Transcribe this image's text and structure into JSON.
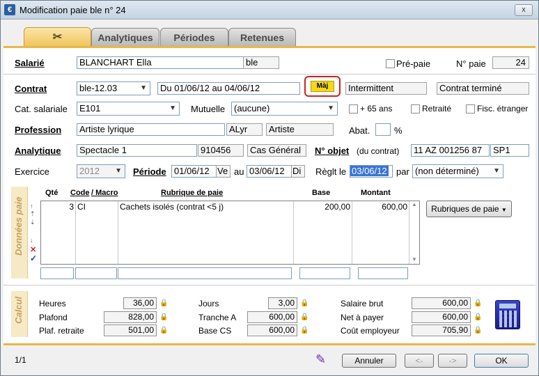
{
  "window": {
    "title": "Modification paie ble n° 24",
    "close_label": "x"
  },
  "tabs": [
    {
      "label": "",
      "icon": "tools-icon"
    },
    {
      "label": "Analytiques"
    },
    {
      "label": "Périodes"
    },
    {
      "label": "Retenues"
    }
  ],
  "salarie": {
    "label": "Salarié",
    "name": "BLANCHART Ella",
    "code": "ble",
    "prepaie_label": "Pré-paie",
    "npaie_label": "N° paie",
    "npaie": "24"
  },
  "contrat": {
    "label": "Contrat",
    "value": "ble-12.03",
    "dates": "Du 01/06/12 au 04/06/12",
    "maj_label": "Màj",
    "type": "Intermittent",
    "status": "Contrat terminé"
  },
  "cat": {
    "label": "Cat. salariale",
    "value": "E101",
    "mutuelle_label": "Mutuelle",
    "mutuelle": "(aucune)",
    "plus65_label": "+ 65 ans",
    "retraite_label": "Retraité",
    "fisc_label": "Fisc. étranger"
  },
  "profession": {
    "label": "Profession",
    "value": "Artiste lyrique",
    "code": "ALyr",
    "short": "Artiste",
    "abat_label": "Abat.",
    "abat": "",
    "pct": "%"
  },
  "analytique": {
    "label": "Analytique",
    "value": "Spectacle 1",
    "code": "910456",
    "cas": "Cas Général",
    "nobjet_label": "N° objet",
    "nobjet_sub": "(du contrat)",
    "nobjet": "11 AZ 001256 87",
    "nobjet2": "SP1"
  },
  "exercice": {
    "label": "Exercice",
    "value": "2012",
    "periode_label": "Période",
    "du": "01/06/12",
    "du_day": "Ve",
    "au_label": "au",
    "au": "03/06/12",
    "au_day": "Di",
    "reglt_label": "Règlt le",
    "reglt": "03/06/12",
    "par_label": "par",
    "par": "(non déterminé)"
  },
  "donnees": {
    "side_label": "Données paie",
    "headers": {
      "qte": "Qté",
      "code": "Code",
      "macro": "/ Macro",
      "rubrique": "Rubrique de paie",
      "base": "Base",
      "montant": "Montant"
    },
    "rows": [
      {
        "qte": "3",
        "code": "CI",
        "rubrique": "Cachets isolés (contrat <5 j)",
        "base": "200,00",
        "montant": "600,00"
      }
    ],
    "rubriques_button": "Rubriques de paie"
  },
  "calcul": {
    "side_label": "Calcul",
    "heures_label": "Heures",
    "heures": "36,00",
    "plafond_label": "Plafond",
    "plafond": "828,00",
    "plafr_label": "Plaf. retraite",
    "plafr": "501,00",
    "jours_label": "Jours",
    "jours": "3,00",
    "trancheA_label": "Tranche A",
    "trancheA": "600,00",
    "baseCS_label": "Base CS",
    "baseCS": "600,00",
    "brut_label": "Salaire brut",
    "brut": "600,00",
    "net_label": "Net à payer",
    "net": "600,00",
    "cout_label": "Coût employeur",
    "cout": "705,90"
  },
  "footer": {
    "page": "1/1",
    "annuler": "Annuler",
    "prev": "<-",
    "next": "->",
    "ok": "OK"
  }
}
